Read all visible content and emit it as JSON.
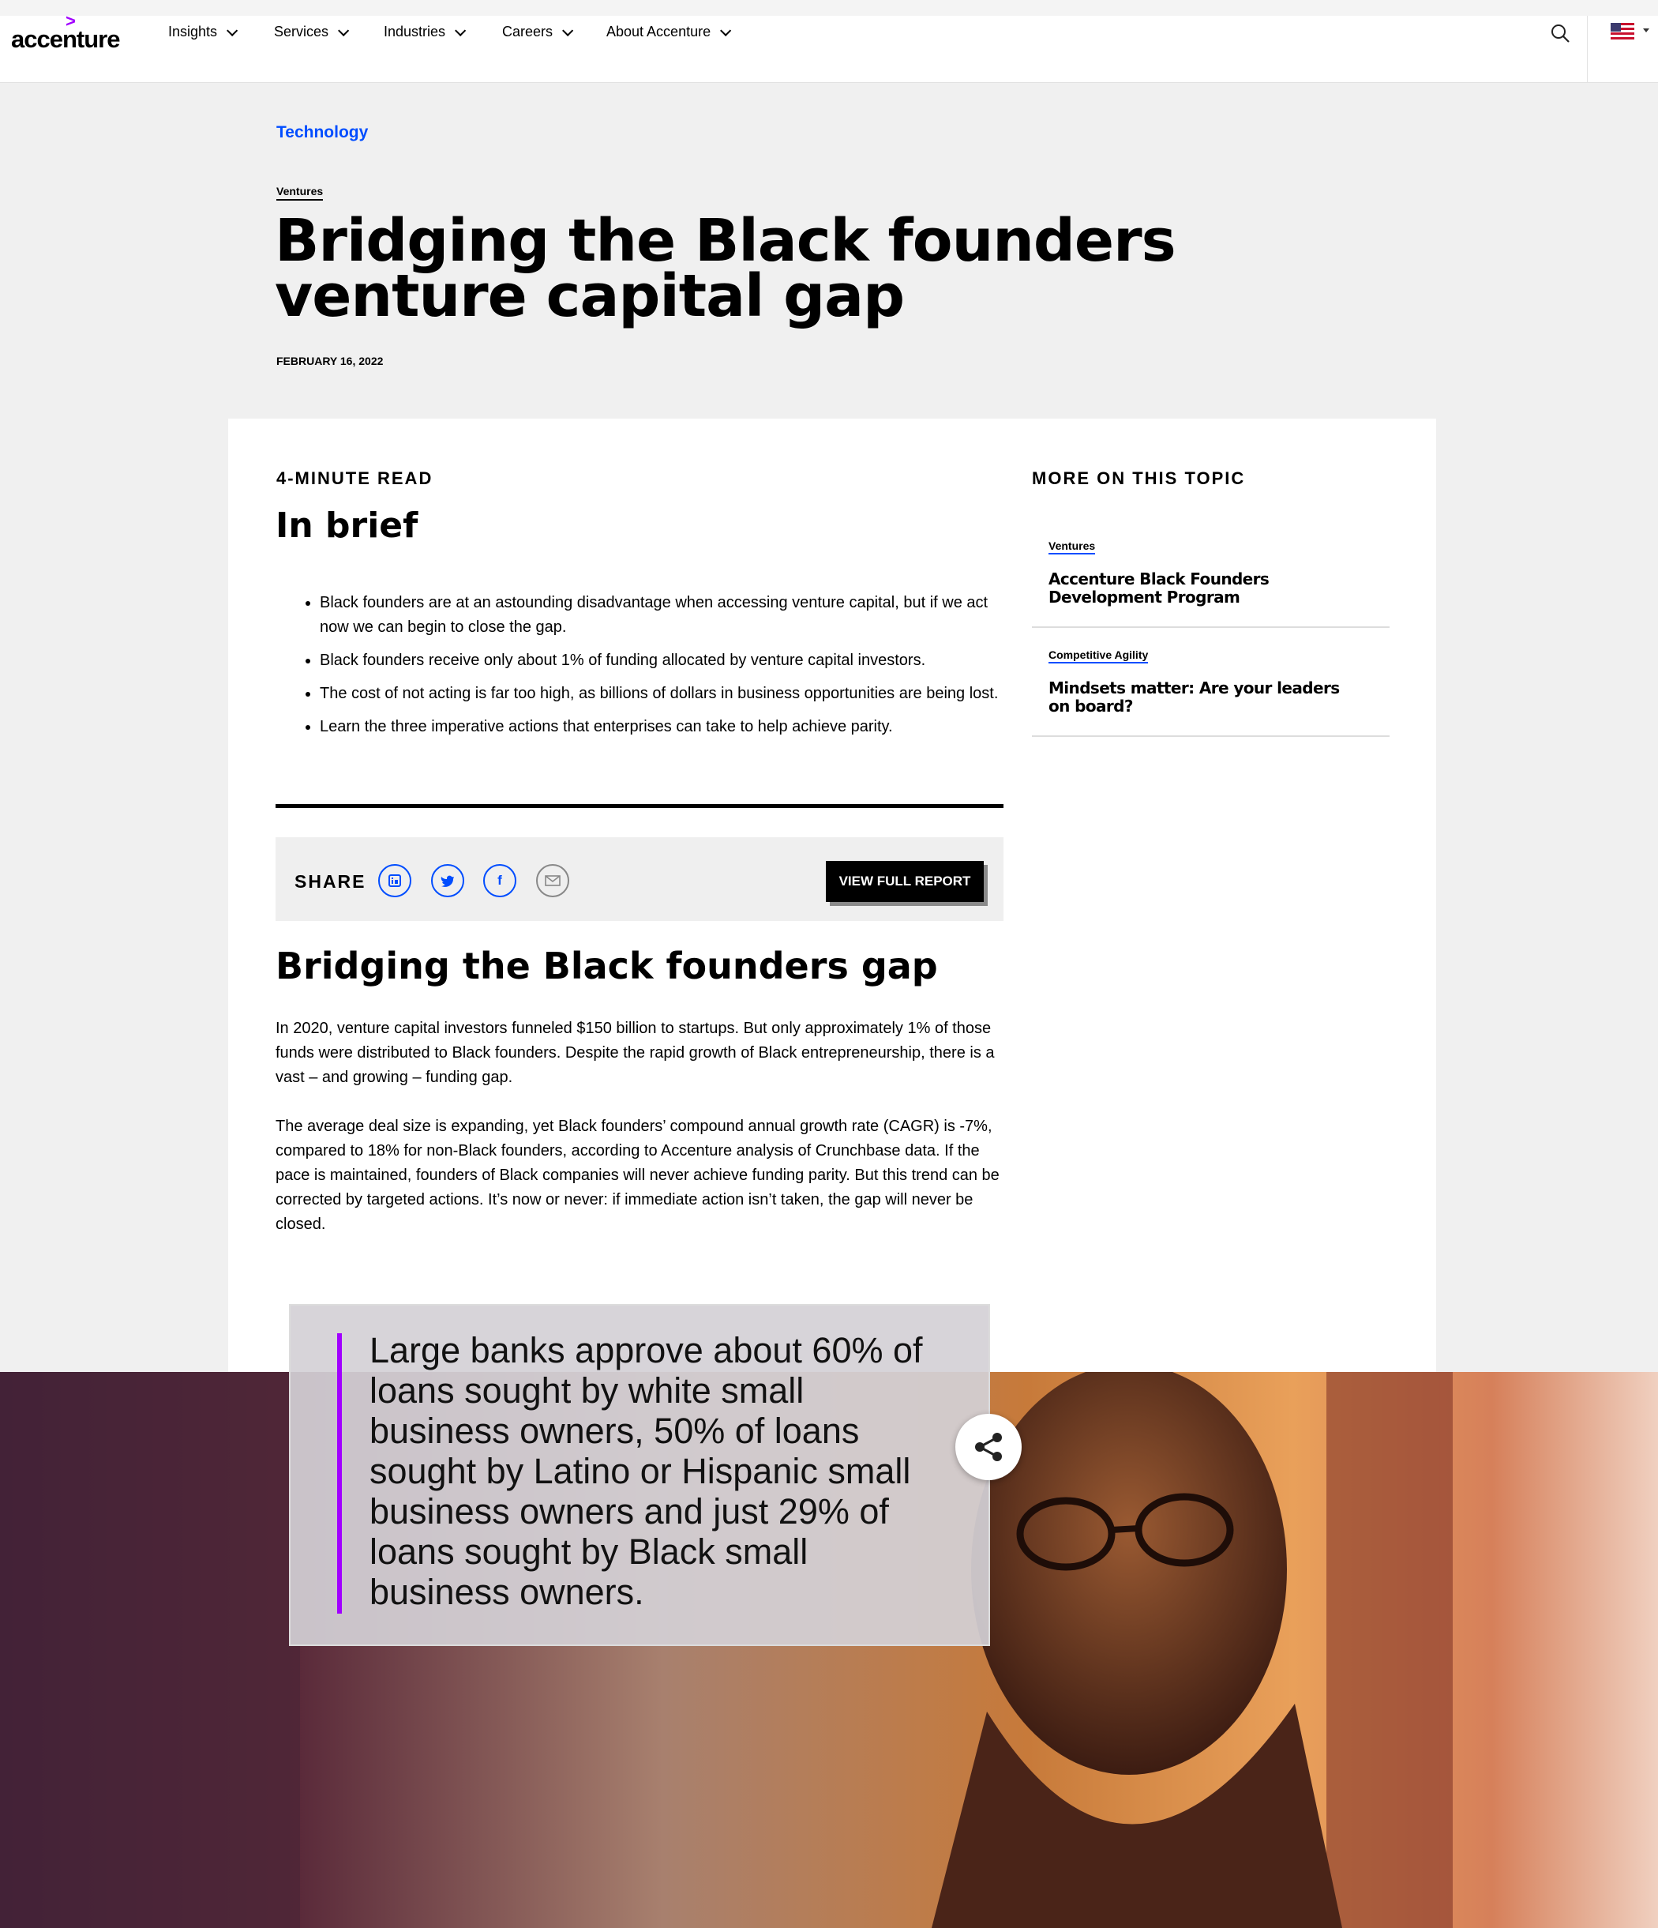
{
  "nav": {
    "logo": "accenture",
    "items": [
      {
        "label": "Insights"
      },
      {
        "label": "Services"
      },
      {
        "label": "Industries"
      },
      {
        "label": "Careers"
      },
      {
        "label": "About Accenture"
      }
    ]
  },
  "header": {
    "category": "Technology",
    "tag": "Ventures",
    "title": "Bridging the Black founders venture capital gap",
    "date": "FEBRUARY 16, 2022"
  },
  "brief": {
    "read_time": "4-MINUTE READ",
    "heading": "In brief",
    "bullets": [
      "Black founders are at an astounding disadvantage when accessing venture capital, but if we act now we can begin to close the gap.",
      "Black founders receive only about 1% of funding allocated by venture capital investors.",
      "The cost of not acting is far too high, as billions of dollars in business opportunities are being lost.",
      "Learn the three imperative actions that enterprises can take to help achieve parity."
    ]
  },
  "share": {
    "label": "SHARE",
    "report_button": "VIEW FULL REPORT"
  },
  "body": {
    "heading": "Bridging the Black founders gap",
    "para1": "In 2020, venture capital investors funneled $150 billion to startups. But only approximately 1% of those funds were distributed to Black founders. Despite the rapid growth of Black entrepreneurship, there is a vast – and growing – funding gap.",
    "para2": "The average deal size is expanding, yet Black founders’ compound annual growth rate (CAGR) is -7%, compared to 18% for non-Black founders, according to Accenture analysis of Crunchbase data. If the pace is maintained, founders of Black companies will never achieve funding parity. But this trend can be corrected by targeted actions. It’s now or never: if immediate action isn’t taken, the gap will never be closed."
  },
  "sidebar": {
    "heading": "MORE ON THIS TOPIC",
    "items": [
      {
        "tag": "Ventures",
        "title": "Accenture Black Founders Development Program"
      },
      {
        "tag": "Competitive Agility",
        "title": "Mindsets matter: Are your leaders on board?"
      }
    ]
  },
  "quote": {
    "text": "Large banks approve about 60% of loans sought by white small business owners, 50% of loans sought by Latino or Hispanic small business owners and just 29% of loans sought by Black small business owners."
  },
  "colors": {
    "accent": "#a100ff",
    "link": "#004dff"
  }
}
